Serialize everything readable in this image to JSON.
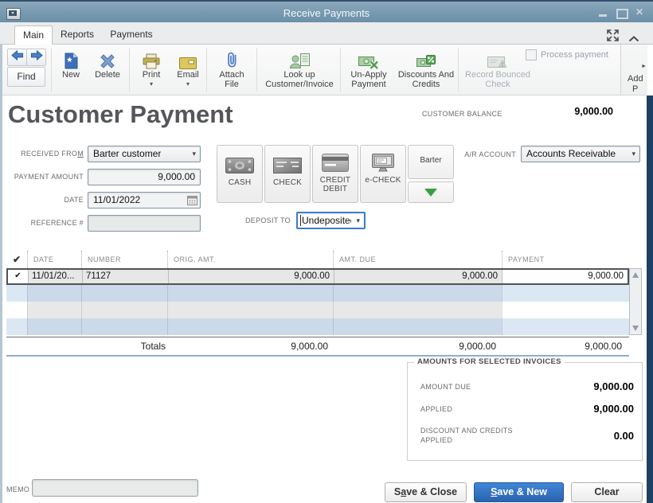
{
  "window": {
    "title": "Receive Payments",
    "controls": {
      "close": "✕"
    }
  },
  "colors": {
    "titlebar": "#7a9cb2",
    "accent_blue": "#2f6fc0",
    "green": "#3f9e41",
    "right_strip": "#1e4062",
    "row_alt_blue": "#ccd9e8",
    "selected_row_border": "#525252"
  },
  "icons": {
    "dropdown": "▾",
    "overflow_arrow": "►",
    "row_check": "✔"
  },
  "tabs": {
    "items": [
      {
        "label": "Main",
        "active": true
      },
      {
        "label": "Reports",
        "active": false
      },
      {
        "label": "Payments",
        "active": false
      }
    ]
  },
  "toolbar": {
    "find": {
      "label": "Find"
    },
    "items": [
      {
        "label": "New"
      },
      {
        "label": "Delete"
      },
      {
        "label": "Print"
      },
      {
        "label": "Email"
      },
      {
        "label": "Attach File"
      },
      {
        "label": "Look up Customer/Invoice"
      },
      {
        "label": "Un-Apply Payment"
      },
      {
        "label": "Discounts And Credits"
      },
      {
        "label": "Record Bounced Check",
        "disabled": true
      }
    ],
    "process_payment": {
      "label": "Process payment",
      "checked": false
    },
    "overflow": {
      "line1": "Add",
      "line2": "P"
    }
  },
  "header": {
    "title": "Customer Payment",
    "balance_label": "CUSTOMER BALANCE",
    "balance_value": "9,000.00"
  },
  "form": {
    "received_from": {
      "label_pre": "RECEIVED FRO",
      "label_u": "M",
      "value": "Barter customer"
    },
    "payment_amount": {
      "label": "PAYMENT AMOUNT",
      "value": "9,000.00"
    },
    "date": {
      "label": "DATE",
      "value": "11/01/2022"
    },
    "reference": {
      "label": "REFERENCE #",
      "value": ""
    },
    "ar_account": {
      "label": "A/R ACCOUNT",
      "value": "Accounts Receivable"
    },
    "deposit_to": {
      "label": "DEPOSIT TO",
      "value": "Undeposited Fu"
    },
    "memo": {
      "label": "MEMO",
      "value": ""
    }
  },
  "payment_methods": {
    "cash": "CASH",
    "check": "CHECK",
    "credit": "CREDIT DEBIT",
    "echeck": "e-CHECK",
    "barter": "Barter"
  },
  "invoice_table": {
    "columns": {
      "check": "✔",
      "date": "DATE",
      "number": "NUMBER",
      "orig": "ORIG. AMT.",
      "due": "AMT. DUE",
      "payment": "PAYMENT"
    },
    "rows": [
      {
        "check": "✔",
        "date": "11/01/20...",
        "number": "71127",
        "orig": "9,000.00",
        "due": "9,000.00",
        "payment": "9,000.00"
      }
    ],
    "totals": {
      "label": "Totals",
      "orig": "9,000.00",
      "due": "9,000.00",
      "payment": "9,000.00"
    }
  },
  "summary": {
    "title": "AMOUNTS FOR SELECTED INVOICES",
    "amount_due": {
      "label": "AMOUNT DUE",
      "value": "9,000.00"
    },
    "applied": {
      "label": "APPLIED",
      "value": "9,000.00"
    },
    "discount": {
      "label_line1": "DISCOUNT AND CREDITS",
      "label_line2": "APPLIED",
      "value": "0.00"
    }
  },
  "buttons": {
    "save_close": {
      "pre": "S",
      "u": "a",
      "post": "ve & Close"
    },
    "save_new": {
      "pre": "",
      "u": "S",
      "post": "ave & New"
    },
    "clear": {
      "label": "Clear"
    }
  }
}
